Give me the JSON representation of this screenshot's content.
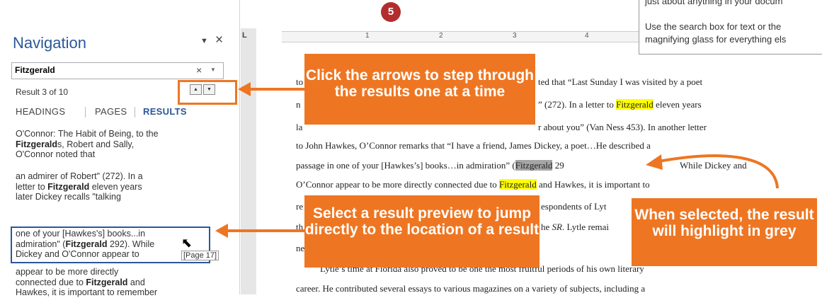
{
  "step_number": "5",
  "navigation": {
    "title": "Navigation",
    "pin_icon": "▼",
    "close_icon": "×",
    "search_value": "Fitzgerald",
    "result_count": "Result 3 of 10",
    "tabs": [
      "HEADINGS",
      "PAGES",
      "RESULTS"
    ],
    "active_tab": "RESULTS",
    "results": [
      {
        "line1": "O'Connor: The Habit of Being, to the",
        "bold2": "Fitzgerald",
        "rest2": "s, Robert and Sally,",
        "line3": "O'Connor noted that"
      },
      {
        "line1": "an admirer of Robert\" (272). In a",
        "pre2": "letter to ",
        "bold2": "Fitzgerald",
        "rest2": " eleven years",
        "line3": "later Dickey recalls \"talking"
      },
      {
        "line1": "one of your [Hawkes's] books...in",
        "pre2": "admiration\" (",
        "bold2": "Fitzgerald",
        "rest2": " 292). While",
        "line3": "Dickey and O'Connor appear to"
      },
      {
        "line1": "appear to be more directly",
        "pre2": "connected due to ",
        "bold2": "Fitzgerald",
        "rest2": " and",
        "line3": "Hawkes, it is important to remember"
      }
    ],
    "page_tooltip": "[Page 17]"
  },
  "ruler": {
    "corner": "L",
    "numbers": [
      "1",
      "2",
      "3",
      "4"
    ]
  },
  "tooltip": {
    "line1": "just about anything in your docum",
    "line2": "Use the search box for text or the",
    "line3": "magnifying glass for everything els"
  },
  "document": {
    "line1_a": "to",
    "line1_b": "ted that “Last Sunday I was visited by a poet",
    "line2_a": "n",
    "line2_b": "” (272). In a letter to ",
    "line2_hl": "Fitzgerald",
    "line2_c": " eleven years",
    "line3_a": "la",
    "line3_b": "r about you” (Van Ness 453). In another letter",
    "line4": "to John Hawkes, O’Connor remarks that “I have a friend, James Dickey, a poet…He described a",
    "line5_a": "passage in one of your [Hawkes’s] books…in admiration” (",
    "line5_hl": "Fitzgerald",
    "line5_b": " 29",
    "line5_c": "While Dickey and",
    "line6_a": "O’Connor appear to be more directly connected due to ",
    "line6_hl": "Fitzgerald",
    "line6_b": " and Hawkes, it is important to",
    "line7_a": "re",
    "line7_b": "espondents of Lyt",
    "line8_a": "th",
    "line8_b": "he ",
    "line8_i": "SR",
    "line8_c": ". Lytle remai",
    "line9_a": "ne",
    "line10": "Lytle’s time at Florida also proved to be one the most fruitful periods of his own literary",
    "line11": "career. He contributed several essays to various magazines on a variety of subjects, including a"
  },
  "callouts": {
    "arrows": "Click the arrows to step through the results one at a time",
    "preview": "Select a result preview to jump directly to the location of a result",
    "selected": "When selected, the result will highlight in grey"
  },
  "colors": {
    "accent": "#2b579a",
    "callout": "#ee7622",
    "highlight": "#ffff00",
    "selection": "#a5a5a5",
    "step_badge": "#b32d2e"
  }
}
